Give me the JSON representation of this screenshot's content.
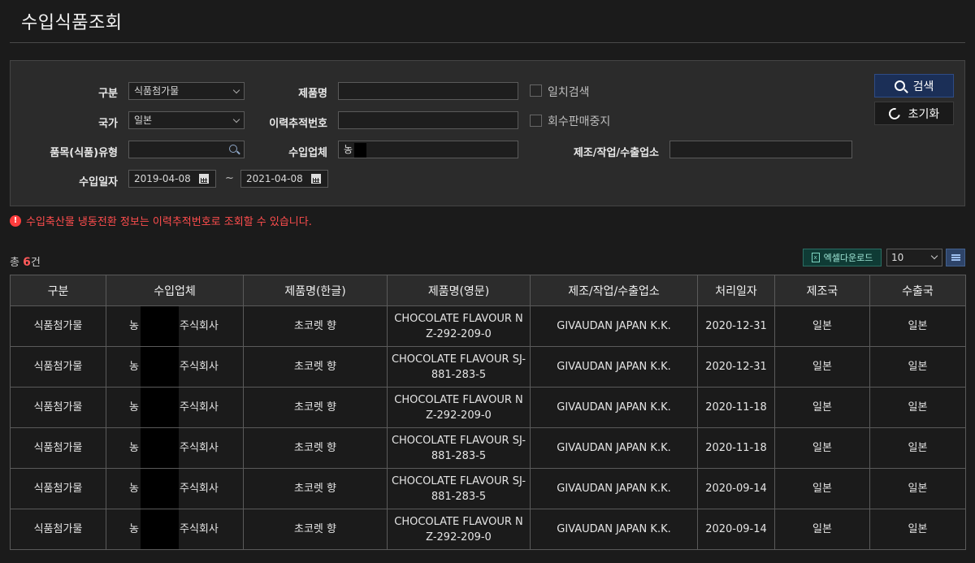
{
  "page": {
    "title": "수입식품조회"
  },
  "search": {
    "category_label": "구분",
    "category_value": "식품첨가물",
    "product_name_label": "제품명",
    "product_name_value": "",
    "exact_match_label": "일치검색",
    "country_label": "국가",
    "country_value": "일본",
    "trace_no_label": "이력추적번호",
    "trace_no_value": "",
    "recall_label": "회수판매중지",
    "item_type_label": "품목(식품)유형",
    "item_type_value": "",
    "importer_label": "수입업체",
    "importer_value": "농",
    "manufacturer_label": "제조/작업/수출업소",
    "manufacturer_value": "",
    "import_date_label": "수입일자",
    "date_from": "2019-04-08",
    "date_sep": "~",
    "date_to": "2021-04-08",
    "search_button": "검색",
    "reset_button": "초기화"
  },
  "notice": "수입축산물 냉동전환 정보는 이력추적번호로 조회할 수 있습니다.",
  "results": {
    "total_prefix": "총 ",
    "total_count": "6",
    "total_suffix": "건",
    "excel_button": "엑셀다운로드",
    "page_size": "10",
    "columns": [
      "구분",
      "수입업체",
      "제품명(한글)",
      "제품명(영문)",
      "제조/작업/수출업소",
      "처리일자",
      "제조국",
      "수출국"
    ],
    "rows": [
      {
        "category": "식품첨가물",
        "importer_first": "농",
        "importer_rest": "주식회사",
        "name_ko": "초코렛 향",
        "name_en": "CHOCOLATE FLAVOUR NZ-292-209-0",
        "maker": "GIVAUDAN JAPAN K.K.",
        "date": "2020-12-31",
        "made_in": "일본",
        "export_from": "일본"
      },
      {
        "category": "식품첨가물",
        "importer_first": "농",
        "importer_rest": "주식회사",
        "name_ko": "초코렛 향",
        "name_en": "CHOCOLATE FLAVOUR SJ-881-283-5",
        "maker": "GIVAUDAN JAPAN K.K.",
        "date": "2020-12-31",
        "made_in": "일본",
        "export_from": "일본"
      },
      {
        "category": "식품첨가물",
        "importer_first": "농",
        "importer_rest": "주식회사",
        "name_ko": "초코렛 향",
        "name_en": "CHOCOLATE FLAVOUR NZ-292-209-0",
        "maker": "GIVAUDAN JAPAN K.K.",
        "date": "2020-11-18",
        "made_in": "일본",
        "export_from": "일본"
      },
      {
        "category": "식품첨가물",
        "importer_first": "농",
        "importer_rest": "주식회사",
        "name_ko": "초코렛 향",
        "name_en": "CHOCOLATE FLAVOUR SJ-881-283-5",
        "maker": "GIVAUDAN JAPAN K.K.",
        "date": "2020-11-18",
        "made_in": "일본",
        "export_from": "일본"
      },
      {
        "category": "식품첨가물",
        "importer_first": "농",
        "importer_rest": "주식회사",
        "name_ko": "초코렛 향",
        "name_en": "CHOCOLATE FLAVOUR SJ-881-283-5",
        "maker": "GIVAUDAN JAPAN K.K.",
        "date": "2020-09-14",
        "made_in": "일본",
        "export_from": "일본"
      },
      {
        "category": "식품첨가물",
        "importer_first": "농",
        "importer_rest": "주식회사",
        "name_ko": "초코렛 향",
        "name_en": "CHOCOLATE FLAVOUR NZ-292-209-0",
        "maker": "GIVAUDAN JAPAN K.K.",
        "date": "2020-09-14",
        "made_in": "일본",
        "export_from": "일본"
      }
    ]
  }
}
